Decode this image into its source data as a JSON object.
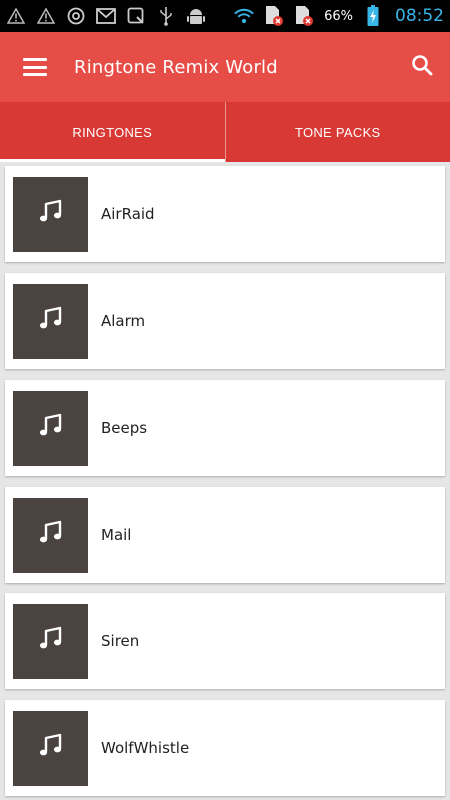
{
  "status_bar": {
    "battery_percent": "66%",
    "time": "08:52",
    "left_icons": [
      "warning-icon",
      "warning-icon",
      "chrome-icon",
      "gmail-icon",
      "screenshot-icon",
      "usb-icon",
      "android-debug-icon"
    ],
    "right_icons": [
      "wifi-icon",
      "sim-no-signal-icon",
      "sim-no-signal-icon",
      "battery-charging-icon"
    ]
  },
  "app_bar": {
    "title": "Ringtone Remix World",
    "menu_icon": "menu-icon",
    "search_icon": "search-icon",
    "color": "#e64d47"
  },
  "tabs": [
    {
      "label": "RINGTONES",
      "active": true
    },
    {
      "label": "TONE PACKS",
      "active": false
    }
  ],
  "tab_bar_color": "#d93935",
  "ringtones": [
    {
      "name": "AirRaid",
      "icon": "music-note-icon"
    },
    {
      "name": "Alarm",
      "icon": "music-note-icon"
    },
    {
      "name": "Beeps",
      "icon": "music-note-icon"
    },
    {
      "name": "Mail",
      "icon": "music-note-icon"
    },
    {
      "name": "Siren",
      "icon": "music-note-icon"
    },
    {
      "name": "WolfWhistle",
      "icon": "music-note-icon"
    }
  ],
  "thumbnail_color": "#4a4340"
}
